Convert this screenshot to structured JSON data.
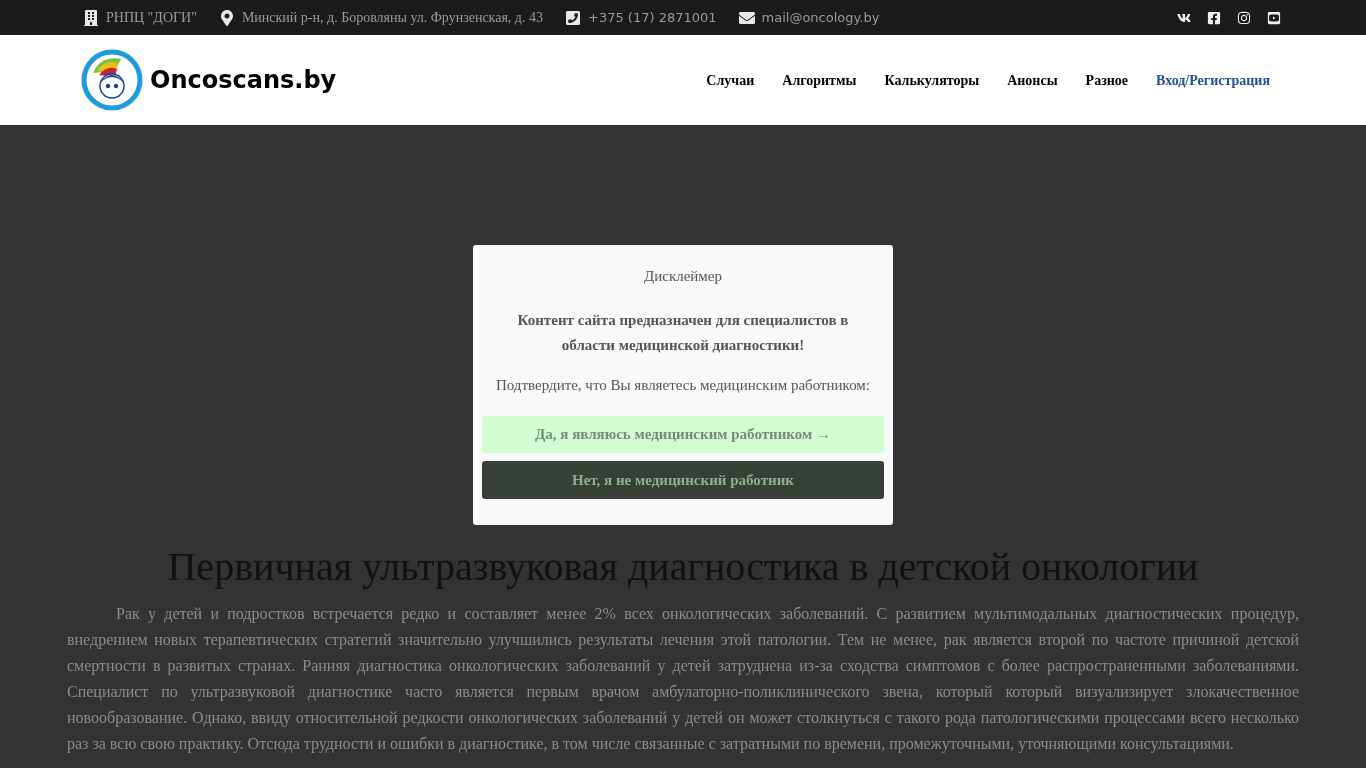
{
  "top_bar": {
    "contacts": [
      {
        "kind": "building",
        "text": "РНПЦ \"ДОГИ\""
      },
      {
        "kind": "pin",
        "text": "Минский р-н, д. Боровляны ул. Фрунзенская, д. 43"
      },
      {
        "kind": "phone",
        "text": "+375 (17) 2871001"
      },
      {
        "kind": "mail",
        "text": "mail@oncology.by"
      }
    ],
    "social": [
      {
        "kind": "vk"
      },
      {
        "kind": "facebook"
      },
      {
        "kind": "instagram"
      },
      {
        "kind": "youtube"
      }
    ]
  },
  "header": {
    "site_name": "Oncoscans.by",
    "nav": [
      {
        "label": "Случаи",
        "kind": "menu"
      },
      {
        "label": "Алгоритмы",
        "kind": "menu"
      },
      {
        "label": "Калькуляторы",
        "kind": "menu"
      },
      {
        "label": "Анонсы",
        "kind": "menu"
      },
      {
        "label": "Разное",
        "kind": "menu"
      },
      {
        "label": "Вход/Регистрация",
        "kind": "account"
      }
    ]
  },
  "dialog": {
    "title": "Дисклеймер",
    "warning": "Контент сайта предназначен для специалистов в области медицинской диагностики!",
    "prompt": "Подтвердите, что Вы являетесь медицинским работником:",
    "confirm_button": "Да, я являюсь медицинским работником →",
    "decline_button": "Нет, я не медицинский работник"
  },
  "article": {
    "title": "Первичная ультразвуковая диагностика в детской онкологии",
    "paragraph": "Рак у детей и подростков встречается редко и составляет менее 2% всех онкологических заболеваний. С развитием мультимодальных диагностических процедур, внедрением новых терапевтических стратегий значительно улучшились результаты лечения этой патологии. Тем не менее, рак является второй по частоте причиной детской смертности в развитых странах. Ранняя диагностика онкологических заболеваний у детей затруднена из-за сходства симптомов с более распространенными заболеваниями. Специалист по ультразвуковой диагностике часто является первым врачом амбулаторно-поликлинического звена, который который визуализирует злокачественное новообразование. Однако, ввиду относительной редкости онкологических заболеваний у детей он может столкнуться с такого рода патологическими процессами всего несколько раз за всю свою практику. Отсюда трудности и ошибки в диагностике, в том числе связанные с затратными по времени, промежуточными, уточняющими консультациями."
  }
}
